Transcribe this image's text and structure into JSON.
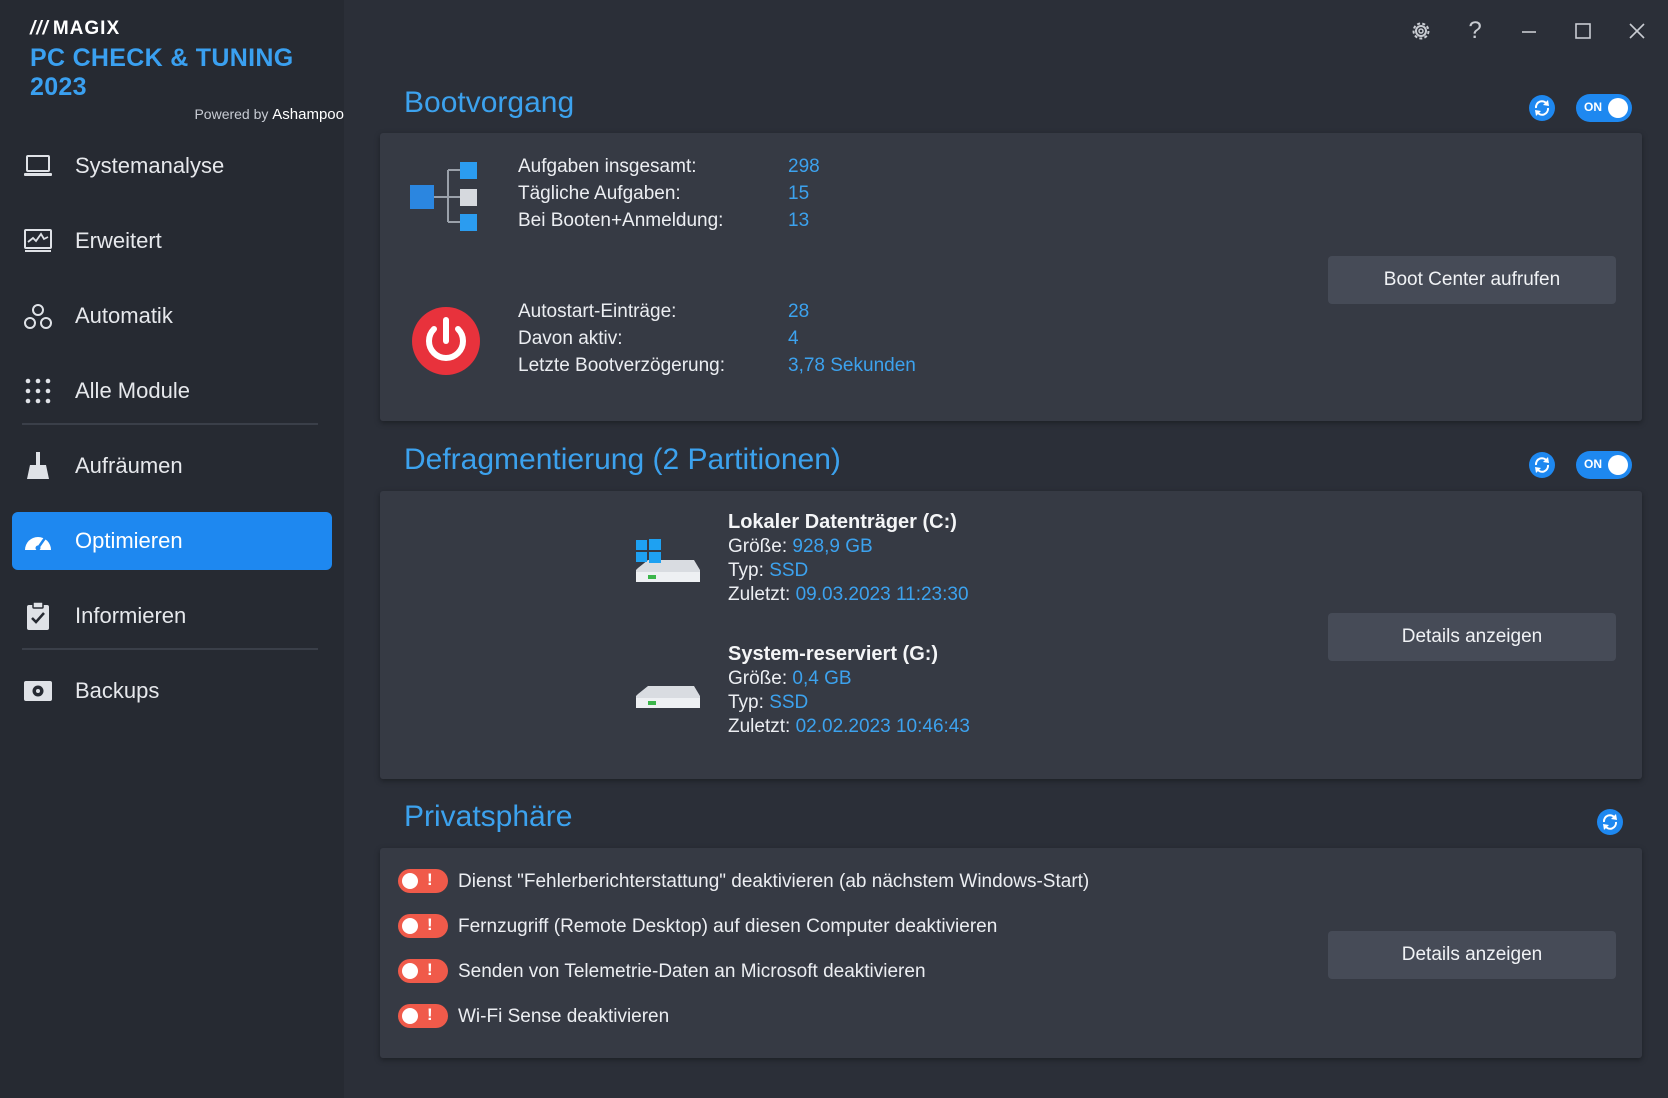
{
  "brand": {
    "magix": "MAGIX",
    "product": "PC CHECK & TUNING 2023",
    "powered_prefix": "Powered by",
    "powered_name": "Ashampoo"
  },
  "sidebar": {
    "items": [
      {
        "label": "Systemanalyse",
        "icon": "laptop-icon"
      },
      {
        "label": "Erweitert",
        "icon": "monitor-chart-icon"
      },
      {
        "label": "Automatik",
        "icon": "automation-icon"
      },
      {
        "label": "Alle Module",
        "icon": "grid-dots-icon"
      },
      {
        "label": "Aufräumen",
        "icon": "broom-icon"
      },
      {
        "label": "Optimieren",
        "icon": "speedometer-icon",
        "active": true
      },
      {
        "label": "Informieren",
        "icon": "clipboard-check-icon"
      },
      {
        "label": "Backups",
        "icon": "backup-drive-icon"
      }
    ]
  },
  "window": {
    "controls": [
      "gear-icon",
      "help-icon",
      "minimize-icon",
      "maximize-icon",
      "close-icon"
    ],
    "help_glyph": "?"
  },
  "boot": {
    "title": "Bootvorgang",
    "toggle": "ON",
    "tasks_total_label": "Aufgaben insgesamt:",
    "tasks_total": "298",
    "daily_label": "Tägliche Aufgaben:",
    "daily": "15",
    "boot_login_label": "Bei Booten+Anmeldung:",
    "boot_login": "13",
    "autostart_label": "Autostart-Einträge:",
    "autostart": "28",
    "active_label": "Davon aktiv:",
    "active": "4",
    "delay_label": "Letzte Bootverzögerung:",
    "delay": "3,78 Sekunden",
    "button": "Boot Center aufrufen"
  },
  "defrag": {
    "title": "Defragmentierung (2 Partitionen)",
    "toggle": "ON",
    "size_label": "Größe:",
    "type_label": "Typ:",
    "last_label": "Zuletzt:",
    "drives": [
      {
        "name": "Lokaler Datenträger (C:)",
        "size": "928,9 GB",
        "type": "SSD",
        "last": "09.03.2023 11:23:30"
      },
      {
        "name": "System-reserviert (G:)",
        "size": "0,4 GB",
        "type": "SSD",
        "last": "02.02.2023 10:46:43"
      }
    ],
    "button": "Details anzeigen"
  },
  "privacy": {
    "title": "Privatsphäre",
    "toggle_mark": "!",
    "items": [
      "Dienst \"Fehlerberichterstattung\" deaktivieren (ab nächstem Windows-Start)",
      "Fernzugriff (Remote Desktop) auf diesen Computer deaktivieren",
      "Senden von Telemetrie-Daten an Microsoft deaktivieren",
      "Wi-Fi Sense deaktivieren"
    ],
    "button": "Details anzeigen"
  },
  "colors": {
    "accent": "#3ca2ee",
    "active_nav": "#1e88f0",
    "warning": "#f05a4a",
    "power_red": "#e8323c"
  }
}
